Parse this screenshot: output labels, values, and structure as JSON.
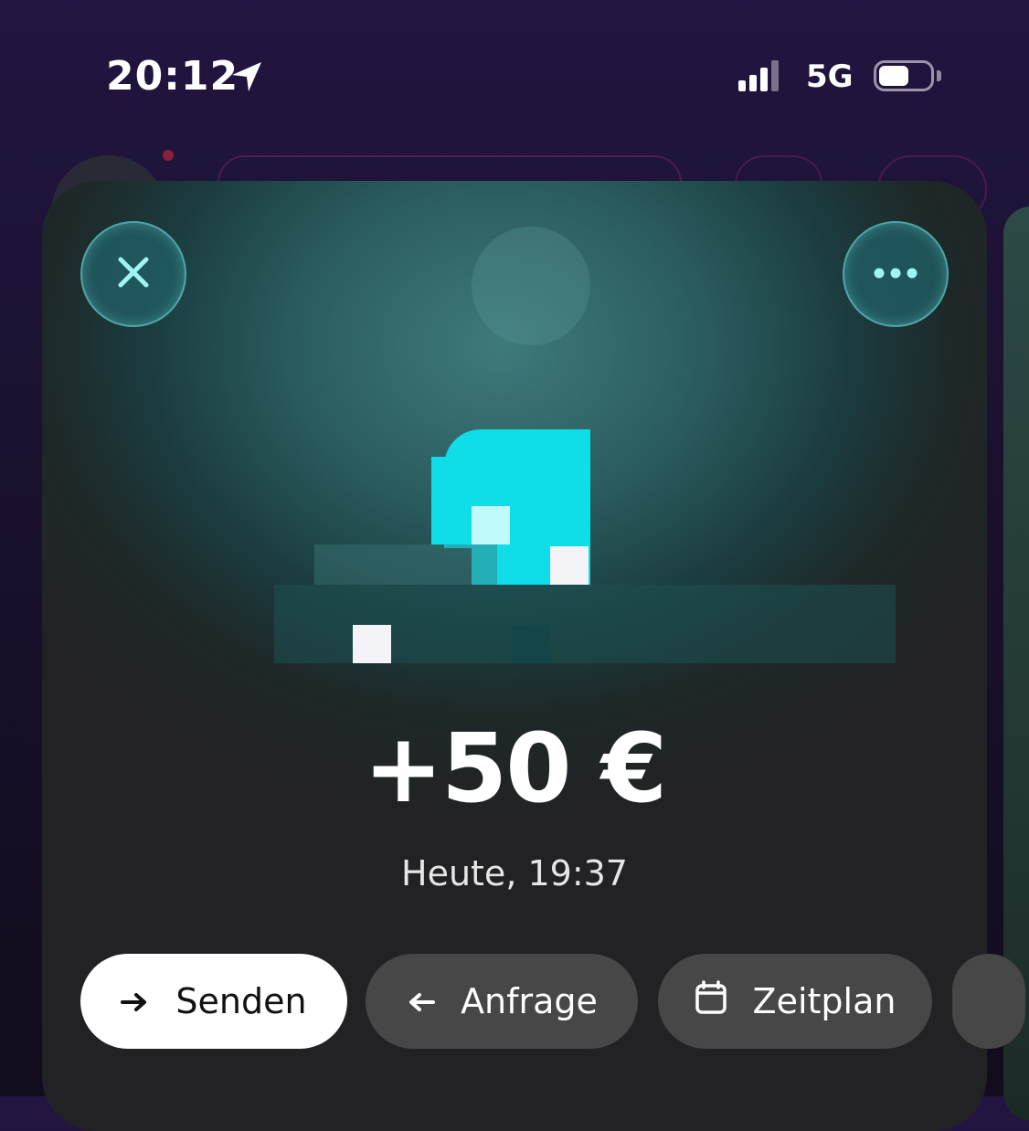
{
  "status_bar": {
    "time": "20:12",
    "network": "5G",
    "location_icon": "location-arrow-icon",
    "signal_icon": "signal-bars-icon",
    "battery_icon": "battery-icon",
    "battery_level": 0.6
  },
  "header": {
    "close_icon": "close-icon",
    "more_icon": "more-horizontal-icon"
  },
  "transaction": {
    "amount": "+50 €",
    "date": "Heute, 19:37"
  },
  "actions": {
    "send": {
      "label": "Senden",
      "icon": "arrow-right-icon"
    },
    "request": {
      "label": "Anfrage",
      "icon": "arrow-left-icon"
    },
    "schedule": {
      "label": "Zeitplan",
      "icon": "calendar-icon"
    }
  },
  "colors": {
    "accent": "#0fdde8",
    "card_top": "#3f7a7b",
    "background": "#221541",
    "pill_dark": "#474747"
  }
}
